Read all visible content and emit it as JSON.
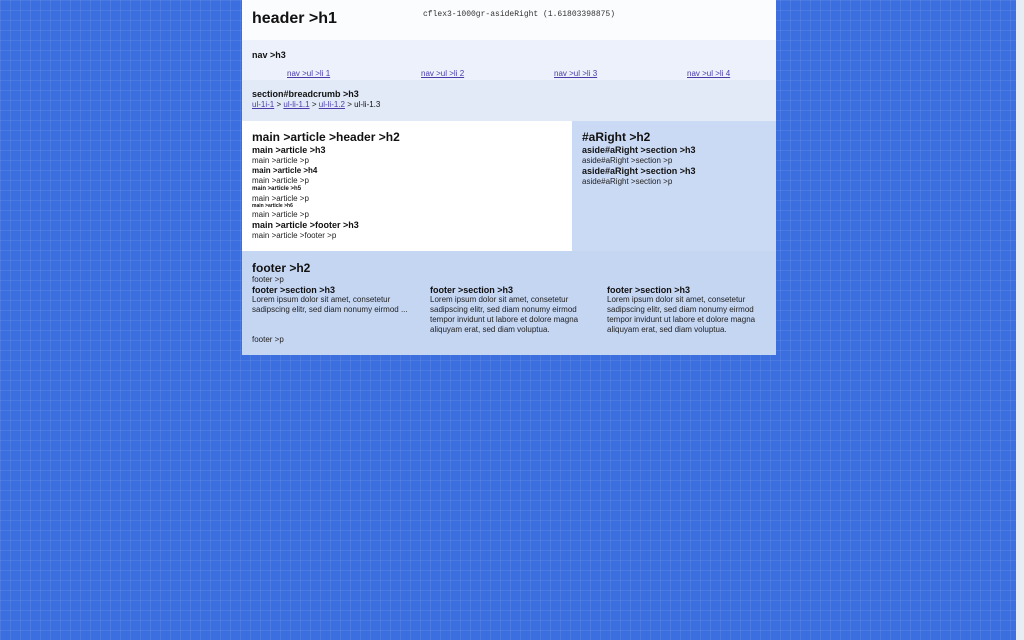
{
  "header": {
    "title": "header >h1",
    "meta": "cflex3-1000gr-asideRight (1.61803398875)"
  },
  "nav": {
    "title": "nav >h3",
    "items": [
      "nav >ul >li 1",
      "nav >ul >li 2",
      "nav >ul >li 3",
      "nav >ul >li 4"
    ]
  },
  "breadcrumb": {
    "title": "section#breadcrumb >h3",
    "items": [
      "ul-1i-1",
      "ul-li-1.1",
      "ul-li-1.2",
      "ul-li-1.3"
    ],
    "separator": ">"
  },
  "main": {
    "h2": "main >article >header >h2",
    "h3": "main >article >h3",
    "p1": "main >article >p",
    "h4": "main >article >h4",
    "p2": "main >article >p",
    "h5": "main >article >h5",
    "p3": "main >article >p",
    "h6": "main >article >h6",
    "p4": "main >article >p",
    "footer_h3": "main >article >footer >h3",
    "footer_p": "main >article >footer >p"
  },
  "aside": {
    "h2": "#aRight >h2",
    "section1_h3": "aside#aRight >section >h3",
    "section1_p": "aside#aRight >section >p",
    "section2_h3": "aside#aRight >section >h3",
    "section2_p": "aside#aRight >section >p"
  },
  "footer": {
    "h2": "footer >h2",
    "p_top": "footer >p",
    "sections": [
      {
        "h3": "footer >section >h3",
        "text": "Lorem ipsum dolor sit amet, consetetur sadipscing elitr, sed diam nonumy eirmod ..."
      },
      {
        "h3": "footer >section >h3",
        "text": "Lorem ipsum dolor sit amet, consetetur sadipscing elitr, sed diam nonumy eirmod tempor invidunt ut labore et dolore magna aliquyam erat, sed diam voluptua."
      },
      {
        "h3": "footer >section >h3",
        "text": "Lorem ipsum dolor sit amet, consetetur sadipscing elitr, sed diam nonumy eirmod tempor invidunt ut labore et dolore magna aliquyam erat, sed diam voluptua."
      }
    ],
    "p_bottom": "footer >p"
  },
  "colors": {
    "background": "#3b6ede",
    "link": "#4b3ba8",
    "aside": "#cbdaf4",
    "footer": "#c5d6f3"
  }
}
